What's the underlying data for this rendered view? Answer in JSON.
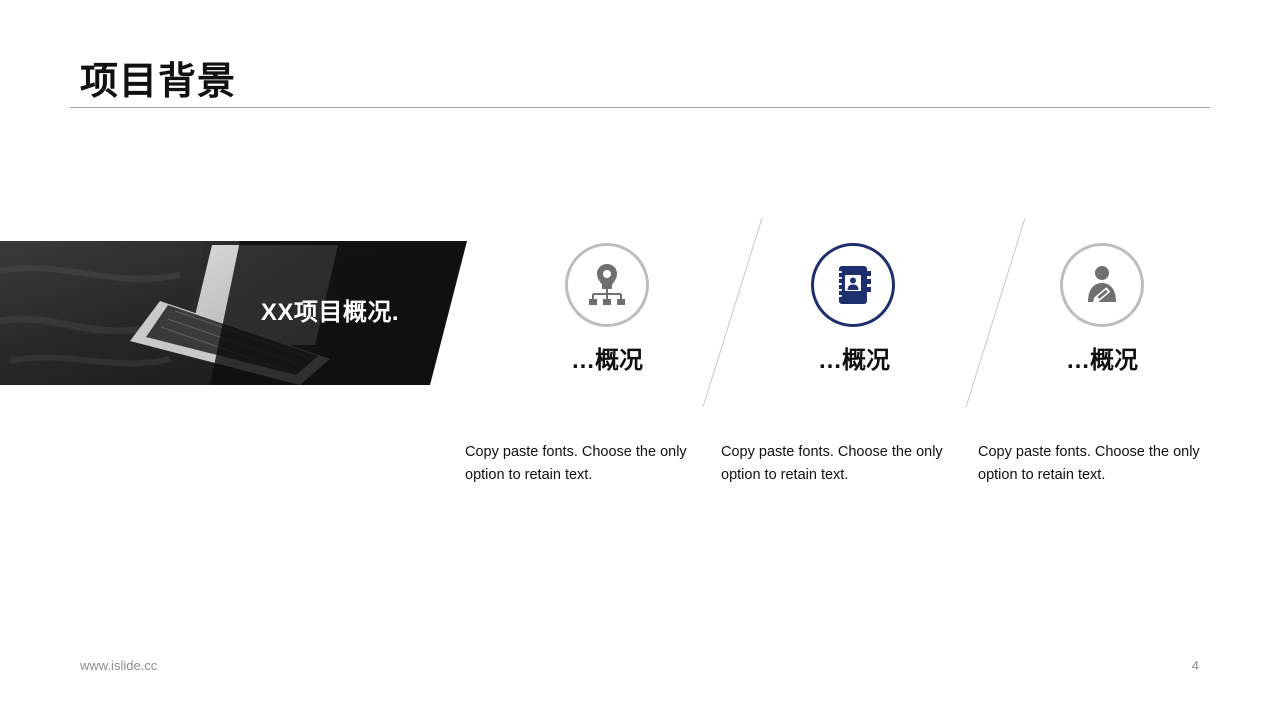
{
  "header": {
    "title": "项目背景"
  },
  "banner": {
    "label": "XX项目概况."
  },
  "features": [
    {
      "icon": "location-hierarchy-icon",
      "title": "…概况",
      "text": "Copy paste fonts. Choose the only option to retain text."
    },
    {
      "icon": "contact-book-icon",
      "title": "…概况",
      "text": "Copy paste fonts. Choose the only option to retain text."
    },
    {
      "icon": "user-edit-icon",
      "title": "…概况",
      "text": "Copy paste fonts. Choose the only option to retain text."
    }
  ],
  "footer": {
    "url": "www.islide.cc",
    "page": "4"
  },
  "colors": {
    "accent": "#1e2f6e",
    "icon_gray": "#6f6f6f",
    "ring_gray": "#bdbdbd",
    "rule": "#a6a6a6"
  }
}
